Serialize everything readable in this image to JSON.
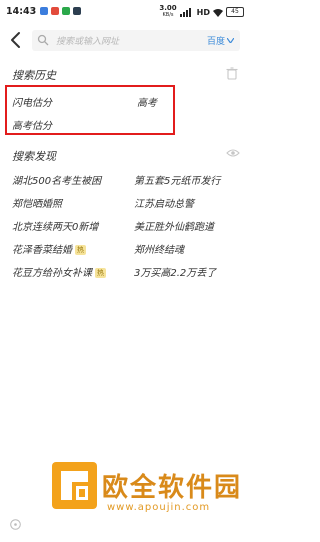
{
  "status_bar": {
    "time": "14:43",
    "network_speed_value": "3.00",
    "network_speed_unit": "KB/s",
    "signal_label": "HD",
    "battery": "45"
  },
  "search": {
    "placeholder": "搜索或输入网址",
    "scope_label": "百度"
  },
  "history": {
    "title": "搜索历史",
    "items": [
      "闪电估分",
      "高考",
      "高考估分"
    ]
  },
  "discover": {
    "title": "搜索发现",
    "items": [
      {
        "label": "湖北500名考生被困",
        "badge": ""
      },
      {
        "label": "第五套5元纸币发行",
        "badge": ""
      },
      {
        "label": "郑恺晒婚照",
        "badge": ""
      },
      {
        "label": "江苏启动总警",
        "badge": ""
      },
      {
        "label": "北京连续两天0新增",
        "badge": ""
      },
      {
        "label": "美正胜外仙鹤跑道",
        "badge": ""
      },
      {
        "label": "花泽香菜结婚",
        "badge": "热"
      },
      {
        "label": "郑州终结魂",
        "badge": ""
      },
      {
        "label": "花豆方给孙女补课",
        "badge": "热"
      },
      {
        "label": "3万买高2.2万丢了",
        "badge": ""
      }
    ]
  },
  "watermark": {
    "title": "欧全软件园",
    "url": "www.apoujin.com"
  }
}
